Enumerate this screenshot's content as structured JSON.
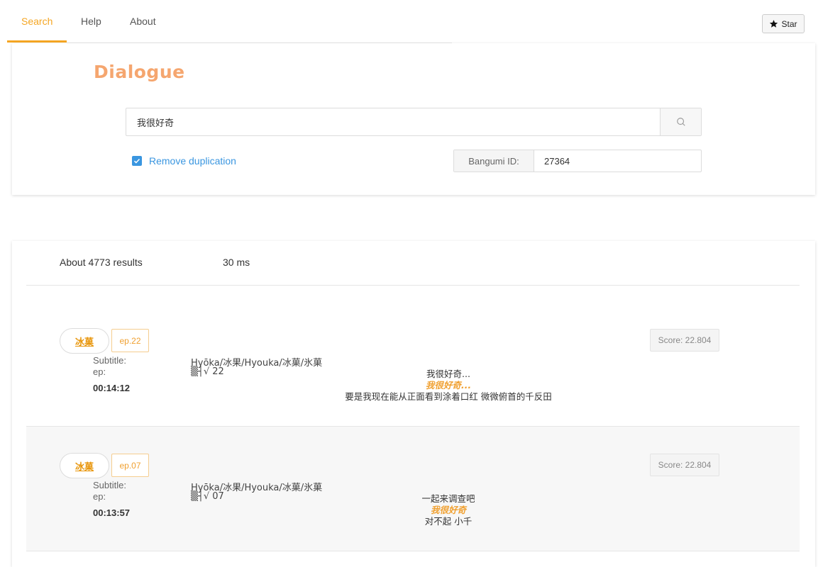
{
  "nav": {
    "tabs": [
      {
        "label": "Search",
        "active": true
      },
      {
        "label": "Help",
        "active": false
      },
      {
        "label": "About",
        "active": false
      }
    ],
    "star_label": "Star"
  },
  "search": {
    "title": "Dialogue",
    "query": "我很好奇",
    "remove_duplication_label": "Remove duplication",
    "remove_duplication_checked": true,
    "bangumi_label": "Bangumi ID:",
    "bangumi_id": "27364"
  },
  "results": {
    "count_text": "About 4773 results",
    "time_text": "30 ms",
    "items": [
      {
        "anime": "冰菓",
        "ep_tag": "ep.22",
        "score": "Score: 22.804",
        "subtitle_label": "Subtitle:",
        "subtitle": "Hyōka/冰果/Hyouka/冰菓/氷菓",
        "ep_label": "ep:",
        "ep": "▒┤√ 22",
        "time": "00:14:12",
        "line_before": "我很好奇...",
        "line_match": "我很好奇...",
        "line_after": "要是我现在能从正面看到涂着口红 微微俯首的千反田"
      },
      {
        "anime": "冰菓",
        "ep_tag": "ep.07",
        "score": "Score: 22.804",
        "subtitle_label": "Subtitle:",
        "subtitle": "Hyōka/冰果/Hyouka/冰菓/氷菓",
        "ep_label": "ep:",
        "ep": "▒┤√ 07",
        "time": "00:13:57",
        "line_before": "一起来调查吧",
        "line_match": "我很好奇",
        "line_after": "对不起 小千"
      }
    ]
  },
  "colors": {
    "accent": "#f5a623",
    "title": "#f5a66f",
    "link_blue": "#3a96e0",
    "highlight": "#f0a030"
  }
}
